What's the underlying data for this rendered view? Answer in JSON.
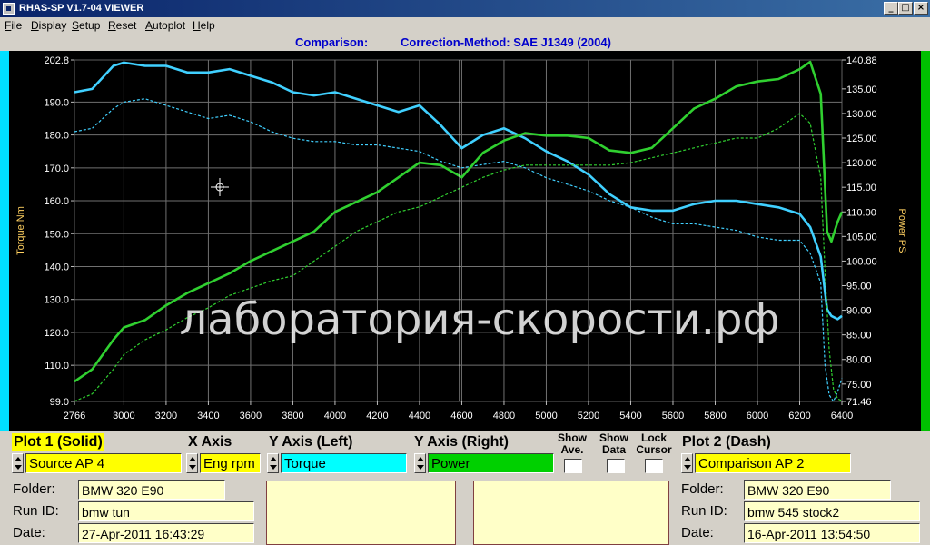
{
  "window": {
    "title": "RHAS-SP V1.7-04  VIEWER",
    "buttons": {
      "minimize": "_",
      "maximize": "□",
      "close": "×"
    }
  },
  "menu": {
    "items": [
      "File",
      "Display",
      "Setup",
      "Reset",
      "Autoplot",
      "Help"
    ]
  },
  "header": {
    "comparison_label": "Comparison:",
    "method_label": "Correction-Method: SAE J1349 (2004)"
  },
  "watermark": "лаборатория-скорости.рф",
  "colors": {
    "torque": "#40d0ff",
    "power": "#30d030",
    "grid": "#808080",
    "yellow": "#ffff00",
    "cyan": "#00ffff",
    "green": "#00d000"
  },
  "chart_data": {
    "type": "line",
    "ylabel": "Torque Nm",
    "y2label": "Power PS",
    "xlim": [
      2766,
      6400
    ],
    "ylim": [
      99.0,
      202.8
    ],
    "y2lim": [
      71.46,
      140.88
    ],
    "x_ticks": [
      "2766",
      "3000",
      "3200",
      "3400",
      "3600",
      "3800",
      "4000",
      "4200",
      "4400",
      "4600",
      "4800",
      "5000",
      "5200",
      "5400",
      "5600",
      "5800",
      "6000",
      "6200",
      "6400"
    ],
    "y_ticks": [
      "202.8",
      "190.0",
      "180.0",
      "170.0",
      "160.0",
      "150.0",
      "140.0",
      "130.0",
      "120.0",
      "110.0",
      "99.0"
    ],
    "y2_ticks": [
      "140.88",
      "135.00",
      "130.00",
      "125.00",
      "120.00",
      "115.00",
      "110.00",
      "105.00",
      "100.00",
      "95.00",
      "90.00",
      "85.00",
      "80.00",
      "75.00",
      "71.46"
    ],
    "cursor_x": 4590,
    "series": [
      {
        "axis": "left",
        "style": "solid",
        "color": "#40d0ff",
        "x": [
          2766,
          2850,
          2950,
          3000,
          3100,
          3200,
          3300,
          3400,
          3500,
          3600,
          3700,
          3800,
          3900,
          4000,
          4100,
          4200,
          4300,
          4400,
          4500,
          4600,
          4700,
          4800,
          4900,
          5000,
          5100,
          5200,
          5300,
          5400,
          5500,
          5600,
          5700,
          5800,
          5900,
          6000,
          6100,
          6200,
          6250,
          6300,
          6330,
          6350,
          6380,
          6400
        ],
        "y": [
          193,
          194,
          201,
          202,
          201,
          201,
          199,
          199,
          200,
          198,
          196,
          193,
          192,
          193,
          191,
          189,
          187,
          189,
          183,
          176,
          180,
          182,
          179,
          175,
          172,
          168,
          162,
          158,
          157,
          157,
          159,
          160,
          160,
          159,
          158,
          156,
          152,
          143,
          127,
          125,
          124,
          125
        ]
      },
      {
        "axis": "left",
        "style": "dash",
        "color": "#40d0ff",
        "x": [
          2766,
          2850,
          2950,
          3000,
          3100,
          3200,
          3300,
          3400,
          3500,
          3600,
          3700,
          3800,
          3900,
          4000,
          4100,
          4200,
          4300,
          4400,
          4500,
          4600,
          4700,
          4800,
          4900,
          5000,
          5100,
          5200,
          5300,
          5400,
          5500,
          5600,
          5700,
          5800,
          5900,
          6000,
          6100,
          6200,
          6250,
          6300,
          6320,
          6340,
          6360,
          6380,
          6400
        ],
        "y": [
          181,
          182,
          188,
          190,
          191,
          189,
          187,
          185,
          186,
          184,
          181,
          179,
          178,
          178,
          177,
          177,
          176,
          175,
          172,
          170,
          171,
          172,
          170,
          167,
          165,
          163,
          160,
          158,
          155,
          153,
          153,
          152,
          151,
          149,
          148,
          148,
          144,
          135,
          110,
          101,
          99,
          102,
          106
        ]
      },
      {
        "axis": "right",
        "style": "solid",
        "color": "#30d030",
        "x": [
          2766,
          2850,
          2950,
          3000,
          3100,
          3200,
          3300,
          3400,
          3500,
          3600,
          3700,
          3800,
          3900,
          4000,
          4100,
          4200,
          4300,
          4400,
          4500,
          4600,
          4700,
          4800,
          4900,
          5000,
          5100,
          5200,
          5300,
          5400,
          5500,
          5600,
          5700,
          5800,
          5900,
          6000,
          6100,
          6200,
          6250,
          6300,
          6330,
          6350,
          6380,
          6400
        ],
        "y": [
          75.5,
          78,
          84,
          86.5,
          88,
          91,
          93.5,
          95.5,
          97.5,
          100,
          102,
          104,
          106,
          110,
          112,
          114,
          117,
          120,
          119.5,
          117,
          122,
          124.5,
          126,
          125.5,
          125.5,
          125,
          122.5,
          122,
          123,
          127,
          131,
          133,
          135.5,
          136.5,
          137,
          139,
          140.5,
          134,
          106,
          104,
          108,
          110
        ]
      },
      {
        "axis": "right",
        "style": "dash",
        "color": "#30d030",
        "x": [
          2766,
          2850,
          2950,
          3000,
          3100,
          3200,
          3300,
          3400,
          3500,
          3600,
          3700,
          3800,
          3900,
          4000,
          4100,
          4200,
          4300,
          4400,
          4500,
          4600,
          4700,
          4800,
          4900,
          5000,
          5100,
          5200,
          5300,
          5400,
          5500,
          5600,
          5700,
          5800,
          5900,
          6000,
          6100,
          6200,
          6250,
          6300,
          6320,
          6340,
          6360,
          6380,
          6400
        ],
        "y": [
          71.5,
          73,
          78,
          81,
          84,
          86,
          88.5,
          90.5,
          93,
          94.5,
          96,
          97,
          100,
          103,
          106,
          108,
          110,
          111,
          113,
          115,
          117,
          118.5,
          119.5,
          119.5,
          119.5,
          119.5,
          119.5,
          120,
          121,
          122,
          123,
          124,
          125,
          125,
          127,
          130,
          128,
          117,
          98,
          82,
          74,
          72,
          71.6
        ]
      }
    ]
  },
  "controls": {
    "plot1_title": "Plot 1 (Solid)",
    "xaxis_title": "X Axis",
    "yleft_title": "Y Axis (Left)",
    "yright_title": "Y Axis (Right)",
    "show_ave": "Show\nAve.",
    "show_data": "Show\nData",
    "lock_cursor": "Lock\nCursor",
    "plot2_title": "Plot 2 (Dash)",
    "source_value": "Source AP 4",
    "xaxis_value": "Eng rpm",
    "yleft_value": "Torque",
    "yright_value": "Power",
    "plot2_value": "Comparison AP 2"
  },
  "info1": {
    "folder_label": "Folder:",
    "folder_value": "BMW 320 E90",
    "runid_label": "Run ID:",
    "runid_value": "bmw tun",
    "date_label": "Date:",
    "date_value": "27-Apr-2011  16:43:29"
  },
  "info2": {
    "folder_label": "Folder:",
    "folder_value": "BMW 320 E90",
    "runid_label": "Run ID:",
    "runid_value": "bmw 545 stock2",
    "date_label": "Date:",
    "date_value": "16-Apr-2011  13:54:50"
  }
}
